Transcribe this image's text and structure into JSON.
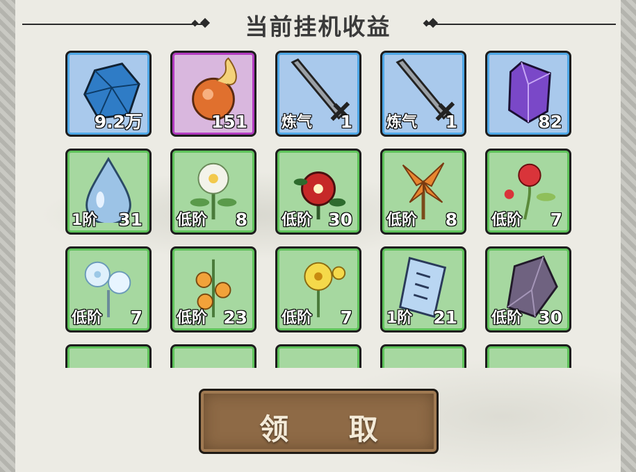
{
  "title": "当前挂机收益",
  "claim_label": "领 取",
  "colors": {
    "rare_frame": "#4ea7e6",
    "epic_frame": "#b23ac0",
    "common_frame": "#5ec35a",
    "button": "#8e6a46"
  },
  "rewards": [
    {
      "icon": "spirit-stone-icon",
      "rarity": "blue",
      "tag": "",
      "qty": "9.2万"
    },
    {
      "icon": "fire-orb-icon",
      "rarity": "purple",
      "tag": "",
      "qty": "151"
    },
    {
      "icon": "sword-icon",
      "rarity": "blue",
      "tag": "炼气",
      "qty": "1"
    },
    {
      "icon": "sword-icon",
      "rarity": "blue",
      "tag": "炼气",
      "qty": "1"
    },
    {
      "icon": "purple-crystal-icon",
      "rarity": "blue",
      "tag": "",
      "qty": "82"
    },
    {
      "icon": "water-drop-icon",
      "rarity": "green",
      "tag": "1阶",
      "qty": "31"
    },
    {
      "icon": "white-flower-icon",
      "rarity": "green",
      "tag": "低阶",
      "qty": "8"
    },
    {
      "icon": "red-flower-icon",
      "rarity": "green",
      "tag": "低阶",
      "qty": "30"
    },
    {
      "icon": "orange-lily-icon",
      "rarity": "green",
      "tag": "低阶",
      "qty": "8"
    },
    {
      "icon": "hibiscus-icon",
      "rarity": "green",
      "tag": "低阶",
      "qty": "7"
    },
    {
      "icon": "ice-flower-icon",
      "rarity": "green",
      "tag": "低阶",
      "qty": "7"
    },
    {
      "icon": "orange-fruit-plant-icon",
      "rarity": "green",
      "tag": "低阶",
      "qty": "23"
    },
    {
      "icon": "yellow-flower-icon",
      "rarity": "green",
      "tag": "低阶",
      "qty": "7"
    },
    {
      "icon": "talisman-icon",
      "rarity": "green",
      "tag": "1阶",
      "qty": "21"
    },
    {
      "icon": "grey-crystal-icon",
      "rarity": "green",
      "tag": "低阶",
      "qty": "30"
    },
    {
      "icon": "teal-ore-icon",
      "rarity": "green",
      "tag": "",
      "qty": ""
    },
    {
      "icon": "green-crystal-icon",
      "rarity": "green",
      "tag": "",
      "qty": ""
    },
    {
      "icon": "violet-shard-icon",
      "rarity": "green",
      "tag": "",
      "qty": ""
    },
    {
      "icon": "golden-leaf-icon",
      "rarity": "green",
      "tag": "",
      "qty": ""
    },
    {
      "icon": "brown-ore-icon",
      "rarity": "green",
      "tag": "",
      "qty": ""
    }
  ]
}
